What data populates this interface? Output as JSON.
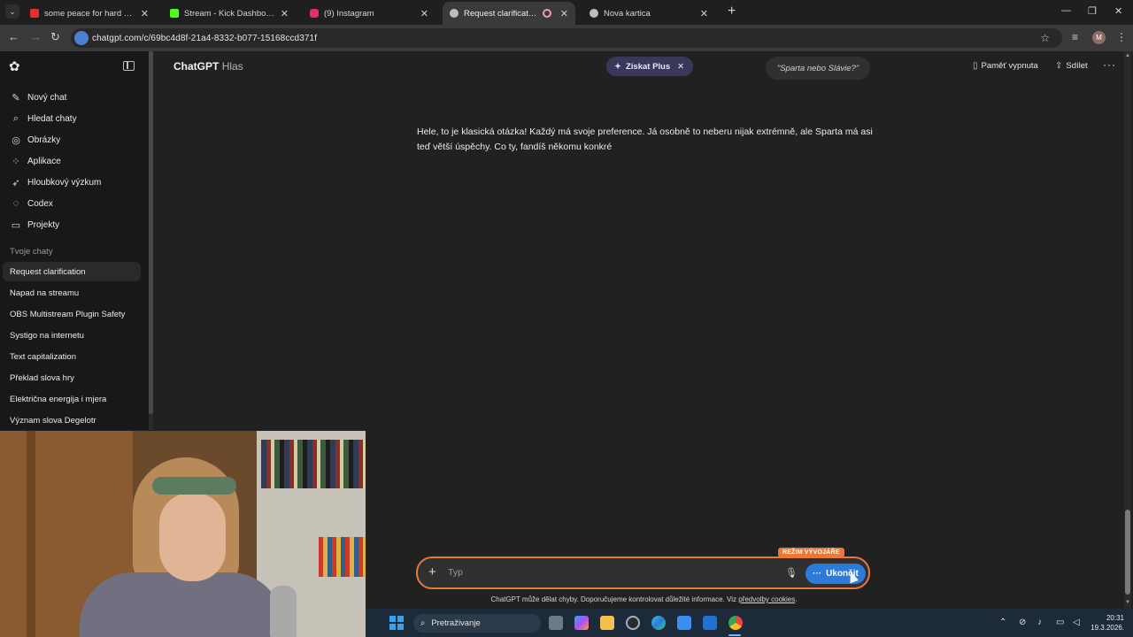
{
  "browser": {
    "tabs": [
      {
        "title": "some peace for hard nights... (m",
        "favicon": "youtube-icon",
        "color": "#e5302d"
      },
      {
        "title": "Stream - Kick Dashboard",
        "favicon": "kick-icon",
        "color": "#53fc18"
      },
      {
        "title": "(9) Instagram",
        "favicon": "instagram-icon",
        "color": "#e1306c"
      },
      {
        "title": "Request clarification",
        "favicon": "chatgpt-icon",
        "color": "#bdbdbd",
        "active": true
      },
      {
        "title": "Nova kartica",
        "favicon": "chrome-icon",
        "color": "#bdbdbd"
      }
    ],
    "url": "chatgpt.com/c/69bc4d8f-21a4-8332-b077-15168ccd371f",
    "profile_initial": "M"
  },
  "sidebar": {
    "nav": [
      {
        "label": "Nový chat",
        "icon": "edit-icon"
      },
      {
        "label": "Hledat chaty",
        "icon": "search-icon"
      },
      {
        "label": "Obrázky",
        "icon": "image-icon"
      },
      {
        "label": "Aplikace",
        "icon": "apps-icon"
      },
      {
        "label": "Hloubkový výzkum",
        "icon": "telescope-icon"
      },
      {
        "label": "Codex",
        "icon": "codex-icon"
      },
      {
        "label": "Projekty",
        "icon": "folder-icon"
      }
    ],
    "section_title": "Tvoje chaty",
    "chats": [
      "Request clarification",
      "Napad na streamu",
      "OBS Multistream Plugin Safety",
      "Systigo na internetu",
      "Text capitalization",
      "Překlad slova hry",
      "Električna energija i mjera",
      "Význam slova Degelotr"
    ]
  },
  "header": {
    "brand": "ChatGPT",
    "brand_sub": "Hlas",
    "plus_label": "Získat Plus",
    "voice_hint": "\"Sparta nebo Slávie?\"",
    "memory_label": "Paměť vypnuta",
    "share_label": "Sdílet"
  },
  "message": {
    "line1": "Hele, to je klasická otázka! Každý má svoje preference. Já osobně to neberu nijak extrémně, ale Sparta má asi",
    "line2": "teď větší úspěchy. Co ty, fandíš někomu konkré"
  },
  "composer": {
    "dev_badge": "REŽIM VÝVOJÁŘE",
    "placeholder": "Typ",
    "end_label": "Ukončit",
    "accent": "#e8793a",
    "end_color": "#2d7bd8"
  },
  "disclaimer": {
    "text": "ChatGPT může dělat chyby. Doporučujeme kontrolovat důležité informace. Viz ",
    "link": "předvolby cookies",
    "suffix": "."
  },
  "taskbar": {
    "search_label": "Pretraživanje",
    "time": "20:31",
    "date": "19.3.2026."
  }
}
